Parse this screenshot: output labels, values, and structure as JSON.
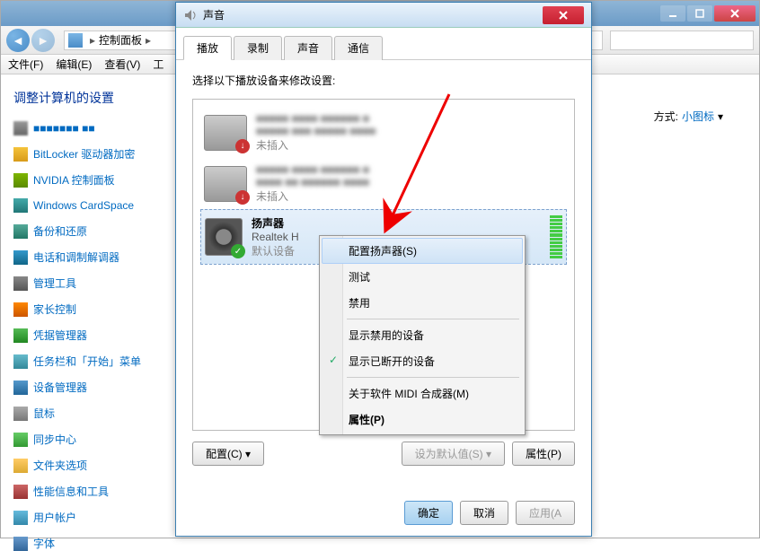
{
  "bg": {
    "breadcrumb": "控制面板",
    "menu": {
      "file": "文件(F)",
      "edit": "编辑(E)",
      "view": "查看(V)",
      "tools": "工"
    },
    "heading": "调整计算机的设置",
    "viewby_label": "方式:",
    "viewby_value": "小图标",
    "sidebar": [
      {
        "label": "■■■■■■■ ■■",
        "cls": "ic-blur"
      },
      {
        "label": "BitLocker 驱动器加密",
        "cls": "ic-lock"
      },
      {
        "label": "NVIDIA 控制面板",
        "cls": "ic-nvidia"
      },
      {
        "label": "Windows CardSpace",
        "cls": "ic-card"
      },
      {
        "label": "备份和还原",
        "cls": "ic-backup"
      },
      {
        "label": "电话和调制解调器",
        "cls": "ic-phone"
      },
      {
        "label": "管理工具",
        "cls": "ic-tool"
      },
      {
        "label": "家长控制",
        "cls": "ic-parent"
      },
      {
        "label": "凭据管理器",
        "cls": "ic-cred"
      },
      {
        "label": "任务栏和「开始」菜单",
        "cls": "ic-task"
      },
      {
        "label": "设备管理器",
        "cls": "ic-devmgr"
      },
      {
        "label": "鼠标",
        "cls": "ic-mouse"
      },
      {
        "label": "同步中心",
        "cls": "ic-sync"
      },
      {
        "label": "文件夹选项",
        "cls": "ic-folder"
      },
      {
        "label": "性能信息和工具",
        "cls": "ic-perf"
      },
      {
        "label": "用户帐户",
        "cls": "ic-user"
      },
      {
        "label": "字体",
        "cls": "ic-font"
      }
    ]
  },
  "dlg": {
    "title": "声音",
    "tabs": {
      "playback": "播放",
      "record": "录制",
      "sound": "声音",
      "comm": "通信"
    },
    "instruction": "选择以下播放设备来修改设置:",
    "devices": [
      {
        "name": "■■■■■ ■■■■ ■■■■■■ ■",
        "desc": "■■■■■ ■■■ ■■■■■ ■■■■",
        "status": "未插入",
        "badge": "down",
        "blur": true
      },
      {
        "name": "■■■■■ ■■■■ ■■■■■■ ■",
        "desc": "■■■■ ■■ ■■■■■■ ■■■■",
        "status": "未插入",
        "badge": "down",
        "blur": true
      },
      {
        "name": "扬声器",
        "desc": "Realtek H",
        "status": "默认设备",
        "badge": "ok",
        "blur": false
      }
    ],
    "btns": {
      "configure": "配置(C)",
      "setdefault": "设为默认值(S)",
      "properties": "属性(P)"
    },
    "footer": {
      "ok": "确定",
      "cancel": "取消",
      "apply": "应用(A"
    }
  },
  "ctx": {
    "configure": "配置扬声器(S)",
    "test": "测试",
    "disable": "禁用",
    "show_disabled": "显示禁用的设备",
    "show_disconnected": "显示已断开的设备",
    "about_midi": "关于软件 MIDI 合成器(M)",
    "properties": "属性(P)"
  }
}
